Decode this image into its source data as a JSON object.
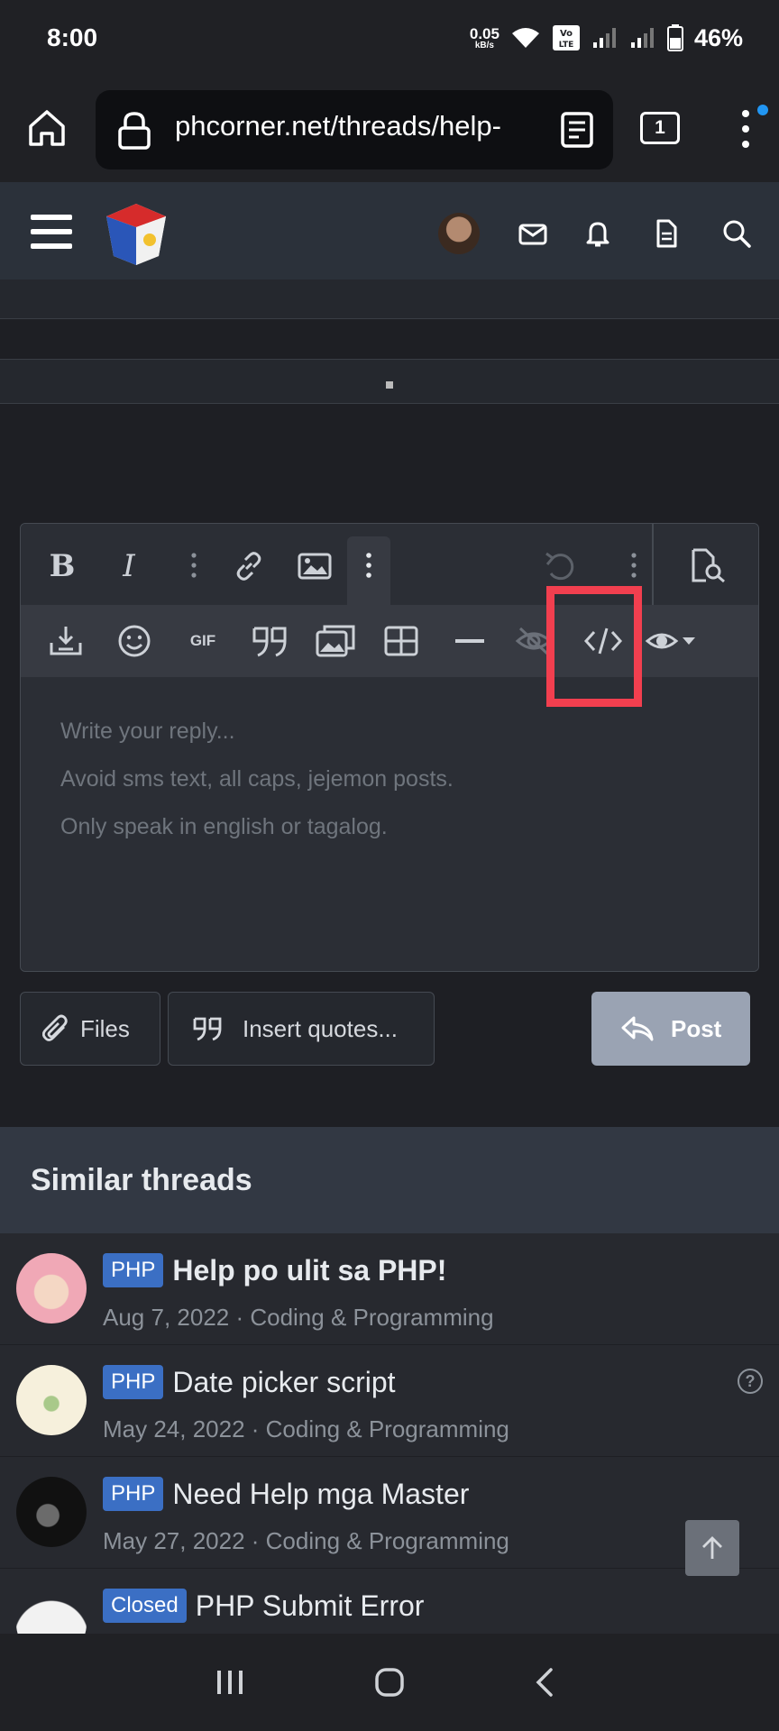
{
  "status": {
    "time": "8:00",
    "net_speed_value": "0.05",
    "net_speed_unit": "kB/s",
    "battery": "46%"
  },
  "browser": {
    "url": "phcorner.net/threads/help-",
    "tab_count": "1"
  },
  "editor": {
    "placeholder_lines": [
      "Write your reply...",
      "Avoid sms text, all caps, jejemon posts.",
      "Only speak in english or tagalog."
    ],
    "gif_label": "GIF"
  },
  "actions": {
    "files_label": "Files",
    "insert_quotes_label": "Insert quotes...",
    "post_label": "Post"
  },
  "similar": {
    "title": "Similar threads",
    "threads": [
      {
        "prefix": "PHP",
        "title": "Help po ulit sa PHP!",
        "meta": "Aug 7, 2022 · Coding & Programming"
      },
      {
        "prefix": "PHP",
        "title": "Date picker script",
        "meta": "May 24, 2022 · Coding & Programming"
      },
      {
        "prefix": "PHP",
        "title": "Need Help mga Master",
        "meta": "May 27, 2022 · Coding & Programming"
      },
      {
        "prefix": "Closed",
        "title": "PHP Submit Error",
        "meta": ""
      }
    ],
    "question_mark": "?"
  },
  "colors": {
    "highlight": "#f23f4f",
    "prefix_bg": "#3b6fc4",
    "post_button": "#9aa3b3"
  }
}
